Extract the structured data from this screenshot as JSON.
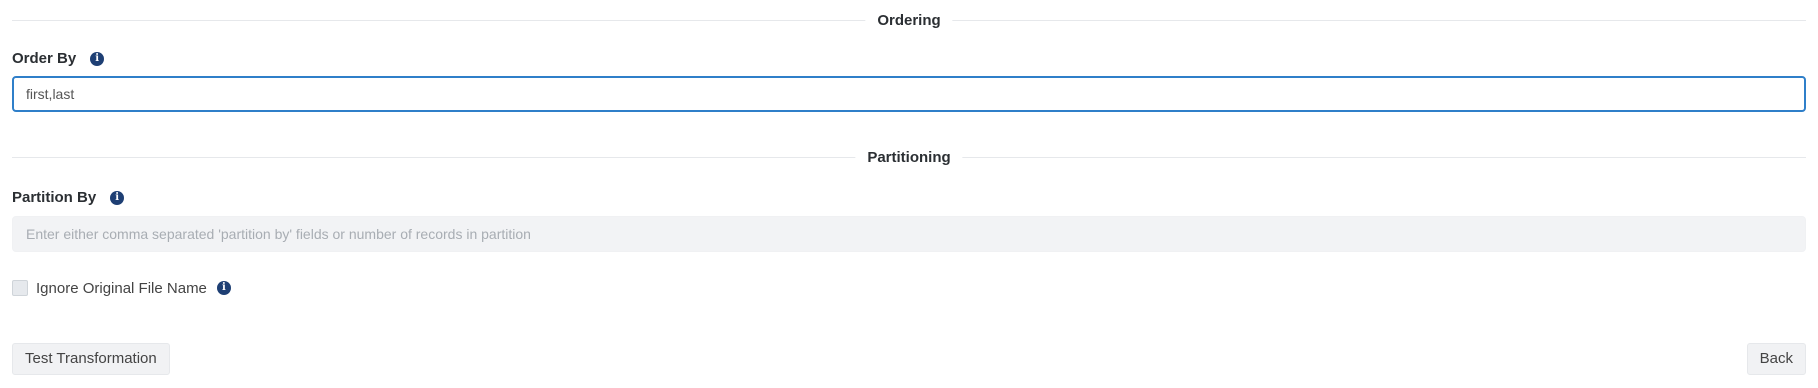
{
  "ordering": {
    "section_title": "Ordering",
    "label": "Order By",
    "value": "first,last"
  },
  "partitioning": {
    "section_title": "Partitioning",
    "label": "Partition By",
    "placeholder": "Enter either comma separated 'partition by' fields or number of records in partition",
    "value": ""
  },
  "ignore_file_name": {
    "label": "Ignore Original File Name",
    "checked": false
  },
  "buttons": {
    "test": "Test Transformation",
    "back": "Back"
  },
  "icons": {
    "info": "info-icon",
    "info_glyph": "i"
  },
  "colors": {
    "accent": "#2f7fc9",
    "info_icon": "#1e3f74"
  }
}
